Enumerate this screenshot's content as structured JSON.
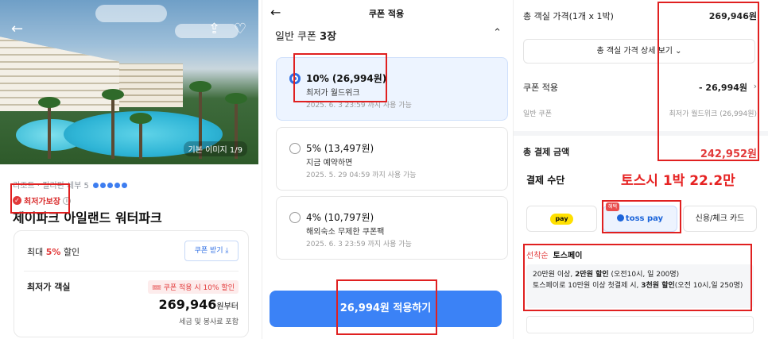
{
  "panel1": {
    "image_counter": "기본 이미지 1/9",
    "breadcrumb": "리조트 · 필리핀 세부 5",
    "badge": "최저가보장",
    "hotel_name": "제이파크 아일랜드 워터파크",
    "discount_prefix": "최대",
    "discount_pct": "5%",
    "discount_suffix": "할인",
    "coupon_button": "쿠폰 받기 ⤓",
    "room_label": "최저가 객실",
    "coupon_tag": "쿠폰 적용 시 10% 할인",
    "price": "269,946",
    "price_unit": "원부터",
    "tax_note": "세금 및 봉사료 포함"
  },
  "panel2": {
    "title": "쿠폰 적용",
    "section": "일반 쿠폰",
    "section_count": "3장",
    "coupons": [
      {
        "title": "10% (26,994원)",
        "desc": "최저가 월드위크",
        "date": "2025. 6. 3 23:59 까지 사용 가능",
        "selected": true
      },
      {
        "title": "5% (13,497원)",
        "desc": "지금 예약하면",
        "date": "2025. 5. 29 04:59 까지 사용 가능",
        "selected": false
      },
      {
        "title": "4% (10,797원)",
        "desc": "해외숙소 무제한 쿠폰팩",
        "date": "2025. 6. 3 23:59 까지 사용 가능",
        "selected": false
      }
    ],
    "apply_button": "26,994원 적용하기"
  },
  "panel3": {
    "room_price_label": "총 객실 가격(1개 x 1박)",
    "room_price": "269,946원",
    "detail_button": "총 객실 가격 상세 보기 ⌄",
    "coupon_label": "쿠폰 적용",
    "coupon_value": "- 26,994원",
    "general_coupon_label": "일반 쿠폰",
    "general_coupon_value": "최저가 월드위크 (26,994원)",
    "total_label": "총 결제 금액",
    "total_value": "242,952원",
    "payment_title": "결제 수단",
    "toss_headline": "토스시 1박 22.2만",
    "pay_methods": {
      "kakao": "pay",
      "toss_badge": "혜택",
      "toss": "toss pay",
      "card": "신용/체크 카드"
    },
    "promo_tag": "선착순",
    "promo_title": "토스페이",
    "promo_line1_a": "20만원 이상, ",
    "promo_line1_b": "2만원 할인",
    "promo_line1_c": " (오전10시, 일 200명)",
    "promo_line2_a": "토스페이로 10만원 이상 첫결제 시, ",
    "promo_line2_b": "3천원 할인",
    "promo_line2_c": "(오전 10시,일 250명)"
  },
  "colors": {
    "accent_blue": "#3b82f6",
    "discount_red": "#e23b3b",
    "annotation_red": "#e02020"
  }
}
